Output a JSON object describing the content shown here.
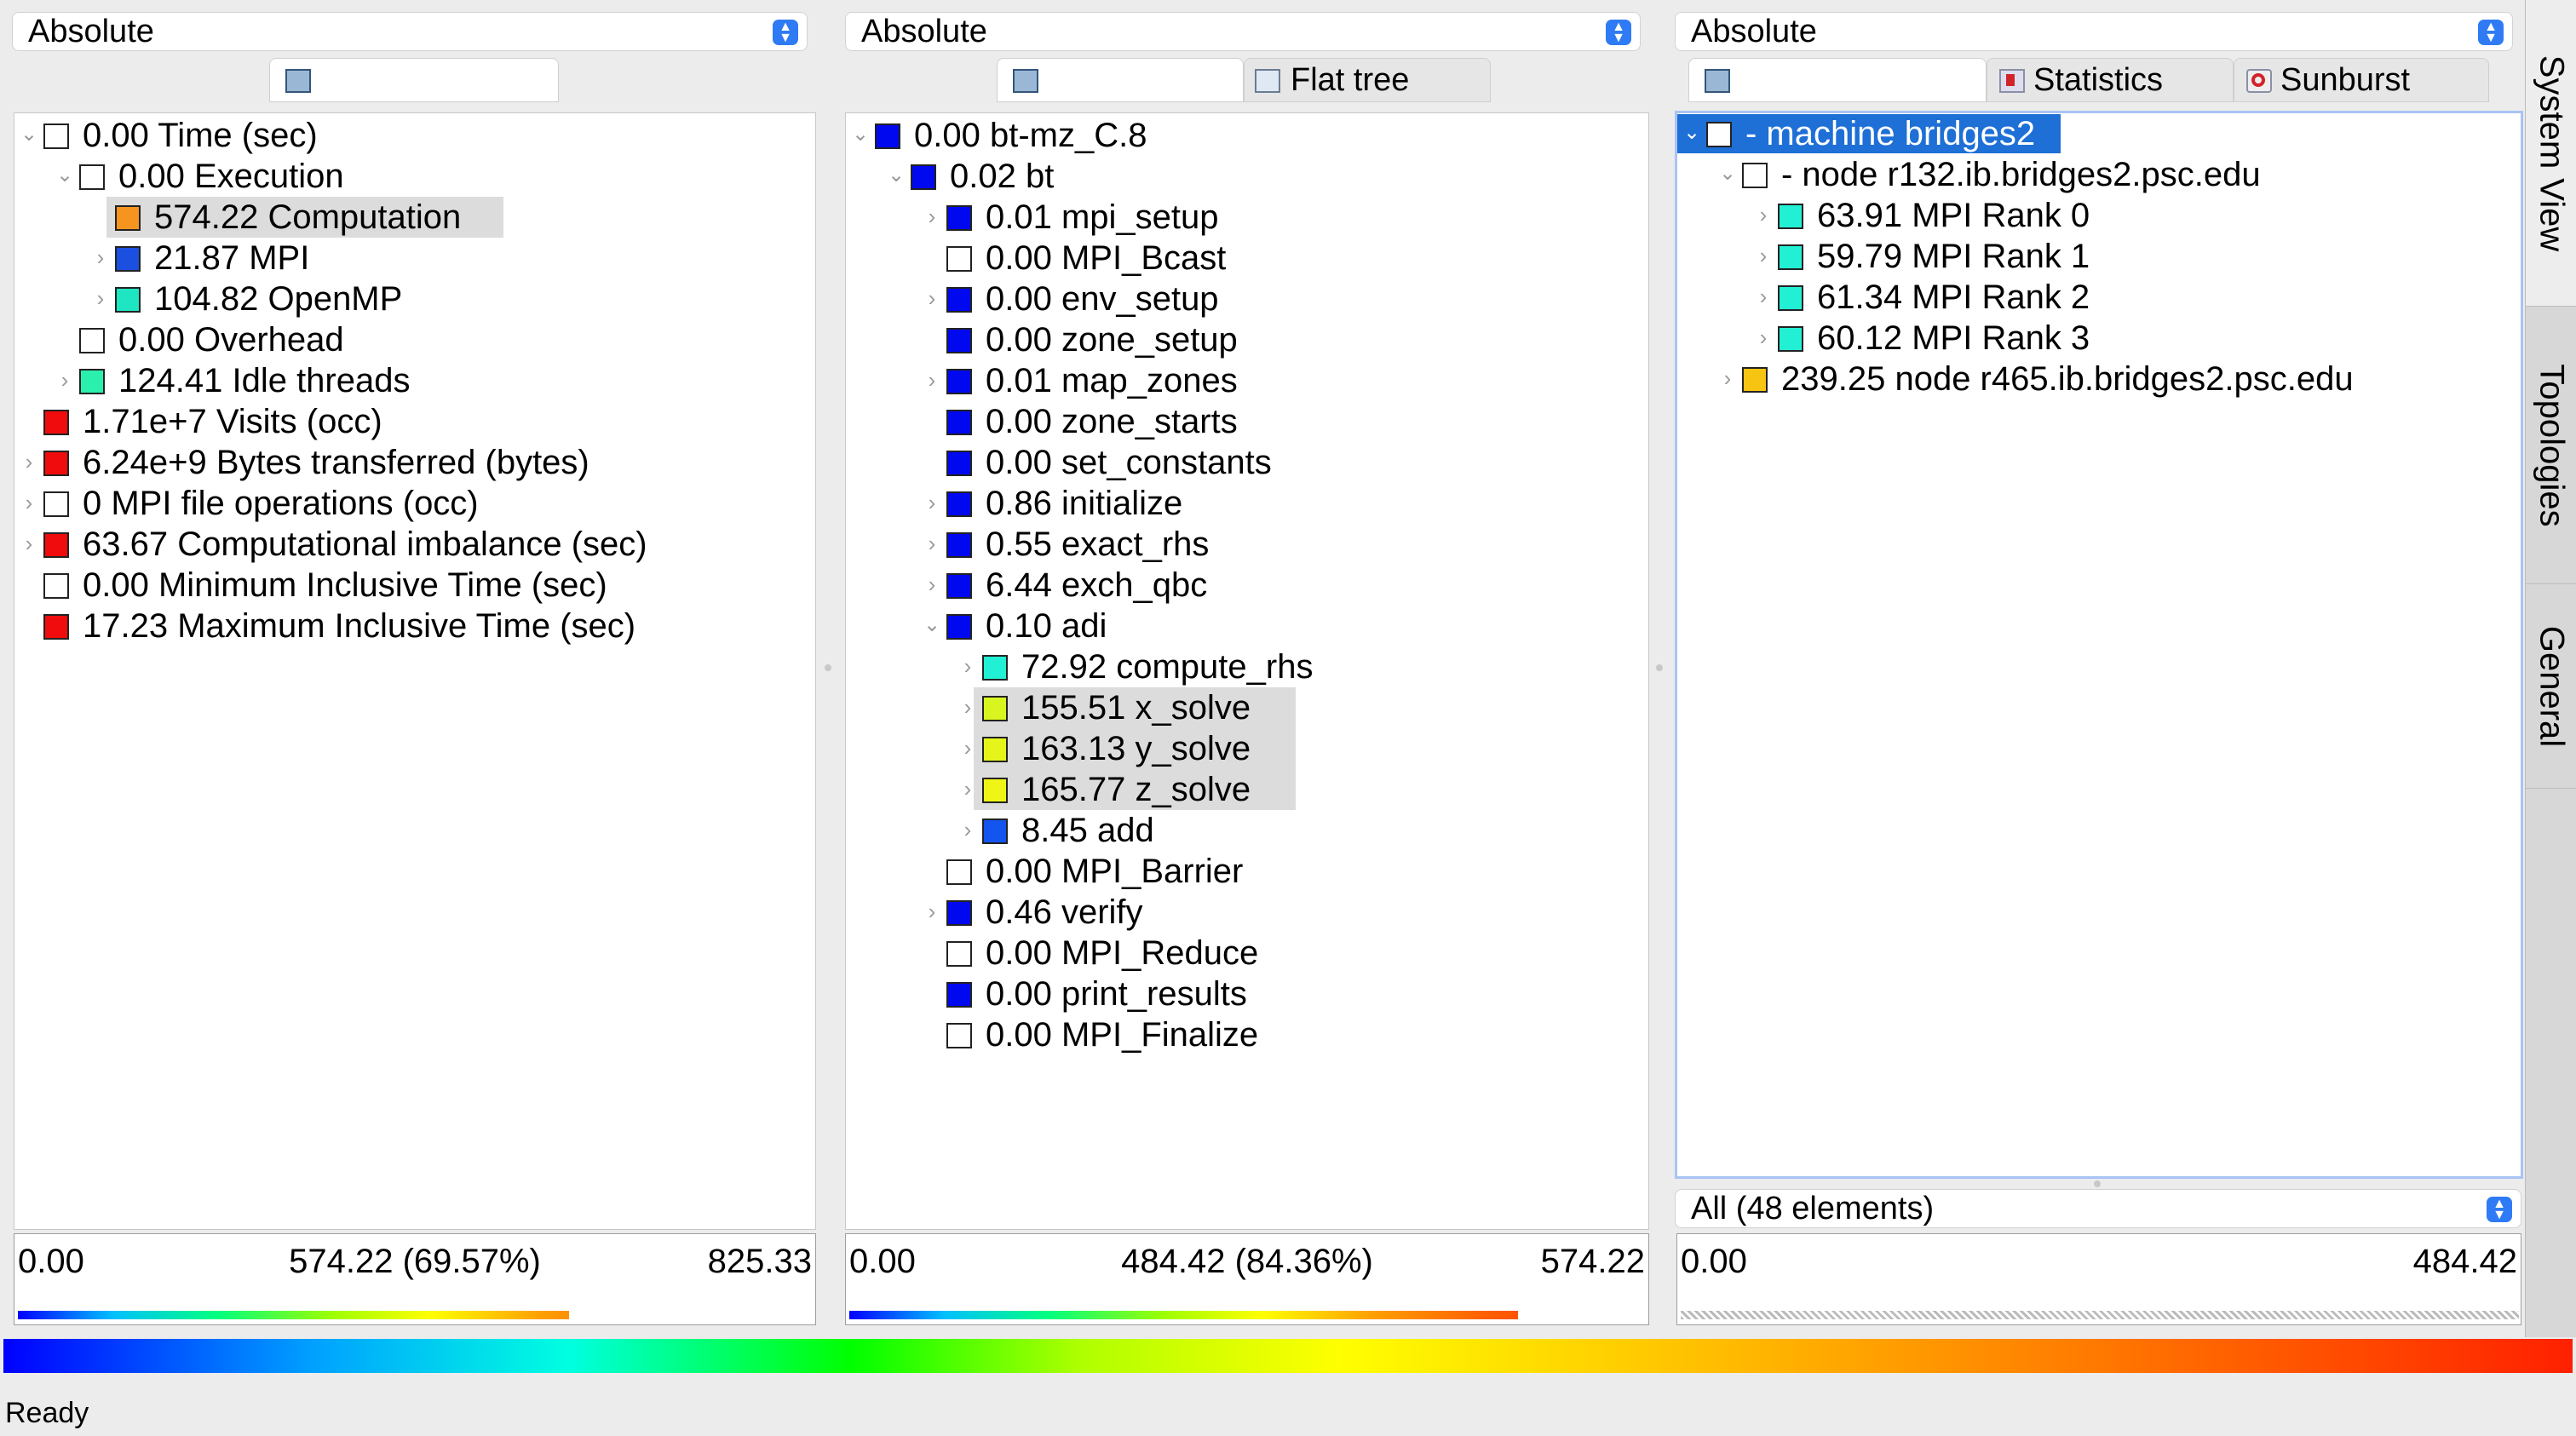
{
  "panels": [
    {
      "combo": "Absolute",
      "tabs": [
        {
          "label": "",
          "icon": "tree-view-icon",
          "active": true
        }
      ],
      "rows": [
        {
          "depth": 0,
          "chev": "down",
          "color": "#ffffff",
          "label": "0.00 Time (sec)"
        },
        {
          "depth": 1,
          "chev": "down",
          "color": "#ffffff",
          "label": "0.00 Execution"
        },
        {
          "depth": 2,
          "chev": "",
          "color": "#f5941f",
          "label": "574.22 Computation",
          "selected": true
        },
        {
          "depth": 2,
          "chev": "right",
          "color": "#1b4fe0",
          "label": "21.87 MPI"
        },
        {
          "depth": 2,
          "chev": "right",
          "color": "#1fe6c2",
          "label": "104.82 OpenMP"
        },
        {
          "depth": 1,
          "chev": "",
          "color": "#ffffff",
          "label": "0.00 Overhead"
        },
        {
          "depth": 1,
          "chev": "right",
          "color": "#2bf0ad",
          "label": "124.41 Idle threads"
        },
        {
          "depth": 0,
          "chev": "",
          "color": "#f00c0c",
          "label": "1.71e+7 Visits (occ)"
        },
        {
          "depth": 0,
          "chev": "right",
          "color": "#f00c0c",
          "label": "6.24e+9 Bytes transferred (bytes)"
        },
        {
          "depth": 0,
          "chev": "right",
          "color": "#ffffff",
          "label": "0 MPI file operations (occ)"
        },
        {
          "depth": 0,
          "chev": "right",
          "color": "#f00c0c",
          "label": "63.67 Computational imbalance (sec)"
        },
        {
          "depth": 0,
          "chev": "",
          "color": "#ffffff",
          "label": "0.00 Minimum Inclusive Time (sec)"
        },
        {
          "depth": 0,
          "chev": "",
          "color": "#f00c0c",
          "label": "17.23 Maximum Inclusive Time (sec)"
        }
      ],
      "scale": {
        "min": "0.00",
        "mid": "574.22 (69.57%)",
        "max": "825.33",
        "fraction": 0.6957
      }
    },
    {
      "combo": "Absolute",
      "tabs": [
        {
          "label": "",
          "icon": "tree-view-icon",
          "active": true
        },
        {
          "label": "Flat tree",
          "icon": "flat-tree-icon",
          "active": false
        }
      ],
      "rows": [
        {
          "depth": 0,
          "chev": "down",
          "color": "#0008f0",
          "label": "0.00 bt-mz_C.8"
        },
        {
          "depth": 1,
          "chev": "down",
          "color": "#0008f0",
          "label": "0.02 bt"
        },
        {
          "depth": 2,
          "chev": "right",
          "color": "#0008f0",
          "label": "0.01 mpi_setup"
        },
        {
          "depth": 2,
          "chev": "",
          "color": "#ffffff",
          "label": "0.00 MPI_Bcast"
        },
        {
          "depth": 2,
          "chev": "right",
          "color": "#0008f0",
          "label": "0.00 env_setup"
        },
        {
          "depth": 2,
          "chev": "",
          "color": "#0008f0",
          "label": "0.00 zone_setup"
        },
        {
          "depth": 2,
          "chev": "right",
          "color": "#0008f0",
          "label": "0.01 map_zones"
        },
        {
          "depth": 2,
          "chev": "",
          "color": "#0008f0",
          "label": "0.00 zone_starts"
        },
        {
          "depth": 2,
          "chev": "",
          "color": "#0008f0",
          "label": "0.00 set_constants"
        },
        {
          "depth": 2,
          "chev": "right",
          "color": "#0008f0",
          "label": "0.86 initialize"
        },
        {
          "depth": 2,
          "chev": "right",
          "color": "#0008f0",
          "label": "0.55 exact_rhs"
        },
        {
          "depth": 2,
          "chev": "right",
          "color": "#0008f0",
          "label": "6.44 exch_qbc"
        },
        {
          "depth": 2,
          "chev": "down",
          "color": "#0008f0",
          "label": "0.10 adi"
        },
        {
          "depth": 3,
          "chev": "right",
          "color": "#22f0d4",
          "label": "72.92 compute_rhs"
        },
        {
          "depth": 3,
          "chev": "right",
          "color": "#d9f51f",
          "label": "155.51 x_solve",
          "selected": true
        },
        {
          "depth": 3,
          "chev": "right",
          "color": "#e5f51a",
          "label": "163.13 y_solve",
          "selected": true
        },
        {
          "depth": 3,
          "chev": "right",
          "color": "#eff515",
          "label": "165.77 z_solve",
          "selected": true
        },
        {
          "depth": 3,
          "chev": "right",
          "color": "#1455f0",
          "label": "8.45 add"
        },
        {
          "depth": 2,
          "chev": "",
          "color": "#ffffff",
          "label": "0.00 MPI_Barrier"
        },
        {
          "depth": 2,
          "chev": "right",
          "color": "#0008f0",
          "label": "0.46 verify"
        },
        {
          "depth": 2,
          "chev": "",
          "color": "#ffffff",
          "label": "0.00 MPI_Reduce"
        },
        {
          "depth": 2,
          "chev": "",
          "color": "#0008f0",
          "label": "0.00 print_results"
        },
        {
          "depth": 2,
          "chev": "",
          "color": "#ffffff",
          "label": "0.00 MPI_Finalize"
        }
      ],
      "scale": {
        "min": "0.00",
        "mid": "484.42 (84.36%)",
        "max": "574.22",
        "fraction": 0.8436
      }
    },
    {
      "combo": "Absolute",
      "tabs": [
        {
          "label": "",
          "icon": "tree-view-icon",
          "active": true
        },
        {
          "label": "Statistics",
          "icon": "statistics-icon",
          "active": false
        },
        {
          "label": "Sunburst",
          "icon": "sunburst-icon",
          "active": false
        }
      ],
      "rows": [
        {
          "depth": 0,
          "chev": "down",
          "color": "#ffffff",
          "label": "- machine bridges2",
          "highlight": true
        },
        {
          "depth": 1,
          "chev": "down",
          "color": "#ffffff",
          "label": "- node r132.ib.bridges2.psc.edu"
        },
        {
          "depth": 2,
          "chev": "right",
          "color": "#22f0d4",
          "label": "63.91 MPI Rank 0"
        },
        {
          "depth": 2,
          "chev": "right",
          "color": "#22f0d4",
          "label": "59.79 MPI Rank 1"
        },
        {
          "depth": 2,
          "chev": "right",
          "color": "#22f0d4",
          "label": "61.34 MPI Rank 2"
        },
        {
          "depth": 2,
          "chev": "right",
          "color": "#22f0d4",
          "label": "60.12 MPI Rank 3"
        },
        {
          "depth": 1,
          "chev": "right",
          "color": "#f7c511",
          "label": "239.25 node r465.ib.bridges2.psc.edu"
        }
      ],
      "filter": "All (48 elements)",
      "scale": {
        "min": "0.00",
        "mid": "",
        "max": "484.42",
        "fraction": 0
      }
    }
  ],
  "side_tabs": [
    "System View",
    "Topologies",
    "General"
  ],
  "status": "Ready"
}
